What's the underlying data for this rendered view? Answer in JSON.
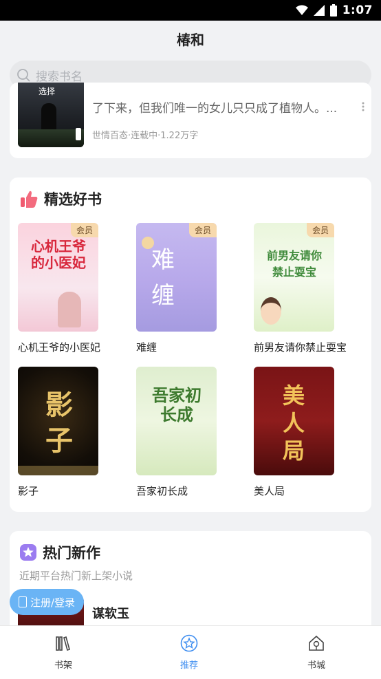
{
  "status_bar": {
    "time": "1:07"
  },
  "app": {
    "title": "椿和"
  },
  "search": {
    "placeholder": "搜索书名"
  },
  "top_book": {
    "cover_title": "选择",
    "description": "了下来，但我们唯一的女儿只只成了植物人。...",
    "meta": "世情百态·连载中·1.22万字"
  },
  "featured": {
    "title": "精选好书",
    "vip_label": "会员",
    "books": [
      {
        "name": "心机王爷的小医妃",
        "cover_text": "心机王爷的小医妃",
        "vip": true
      },
      {
        "name": "难缠",
        "cover_text": "难缠",
        "vip": true
      },
      {
        "name": "前男友请你禁止耍宝",
        "cover_text": "前男友请你禁止耍宝",
        "vip": true
      },
      {
        "name": "影子",
        "cover_text": "影子",
        "vip": false
      },
      {
        "name": "吾家初长成",
        "cover_text": "吾家初长成",
        "vip": false
      },
      {
        "name": "美人局",
        "cover_text": "美人局",
        "vip": false
      }
    ]
  },
  "new_works": {
    "title": "热门新作",
    "subtitle": "近期平台热门新上架小说",
    "first_book": "谋软玉"
  },
  "login_button": "注册/登录",
  "tabs": [
    {
      "label": "书架",
      "icon": "bookshelf-icon"
    },
    {
      "label": "推荐",
      "icon": "star-icon",
      "active": true
    },
    {
      "label": "书城",
      "icon": "bookstore-icon"
    }
  ],
  "colors": {
    "accent": "#3d8df0",
    "login": "#6ab4f5",
    "vip_bg": "#f7d9ad"
  }
}
